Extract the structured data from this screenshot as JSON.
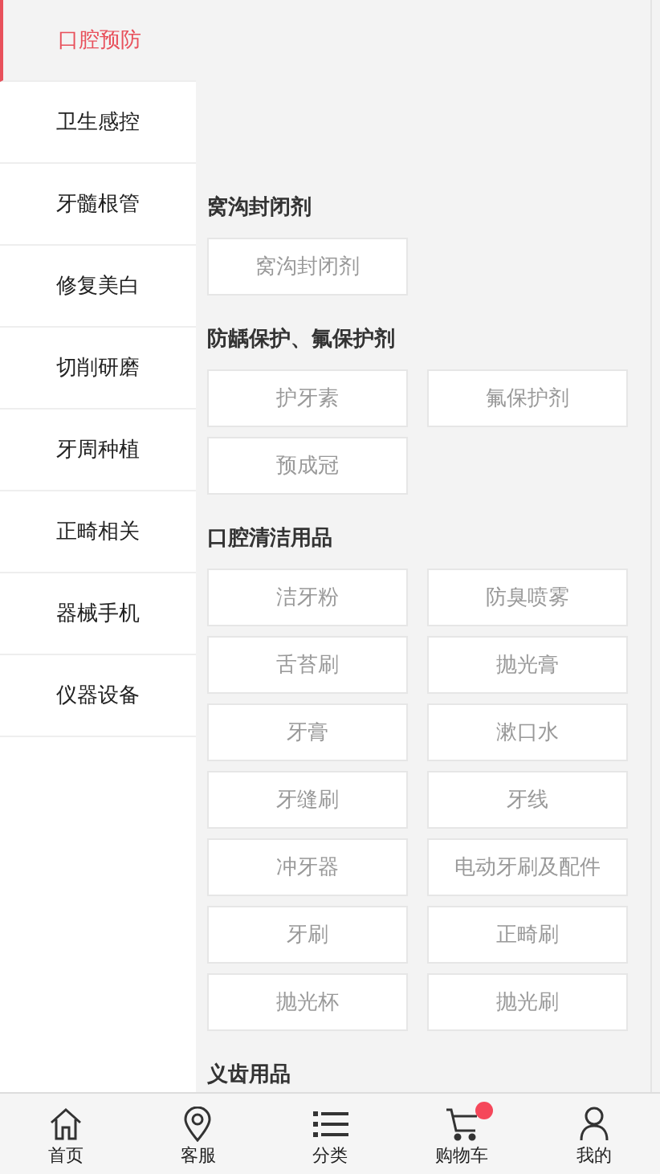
{
  "sidebar": {
    "items": [
      {
        "label": "口腔预防",
        "selected": true
      },
      {
        "label": "卫生感控",
        "selected": false
      },
      {
        "label": "牙髓根管",
        "selected": false
      },
      {
        "label": "修复美白",
        "selected": false
      },
      {
        "label": "切削研磨",
        "selected": false
      },
      {
        "label": "牙周种植",
        "selected": false
      },
      {
        "label": "正畸相关",
        "selected": false
      },
      {
        "label": "器械手机",
        "selected": false
      },
      {
        "label": "仪器设备",
        "selected": false
      }
    ]
  },
  "sections": [
    {
      "title": "窝沟封闭剂",
      "items": [
        "窝沟封闭剂"
      ]
    },
    {
      "title": "防龋保护、氟保护剂",
      "items": [
        "护牙素",
        "氟保护剂",
        "预成冠"
      ]
    },
    {
      "title": "口腔清洁用品",
      "items": [
        "洁牙粉",
        "防臭喷雾",
        "舌苔刷",
        "抛光膏",
        "牙膏",
        "漱口水",
        "牙缝刷",
        "牙线",
        "冲牙器",
        "电动牙刷及配件",
        "牙刷",
        "正畸刷",
        "抛光杯",
        "抛光刷"
      ]
    },
    {
      "title": "义齿用品"
    }
  ],
  "bottom_nav": [
    {
      "label": "首页",
      "kind": "home"
    },
    {
      "label": "客服",
      "kind": "location"
    },
    {
      "label": "分类",
      "kind": "list"
    },
    {
      "label": "购物车",
      "kind": "cart",
      "badge": true
    },
    {
      "label": "我的",
      "kind": "user"
    }
  ]
}
